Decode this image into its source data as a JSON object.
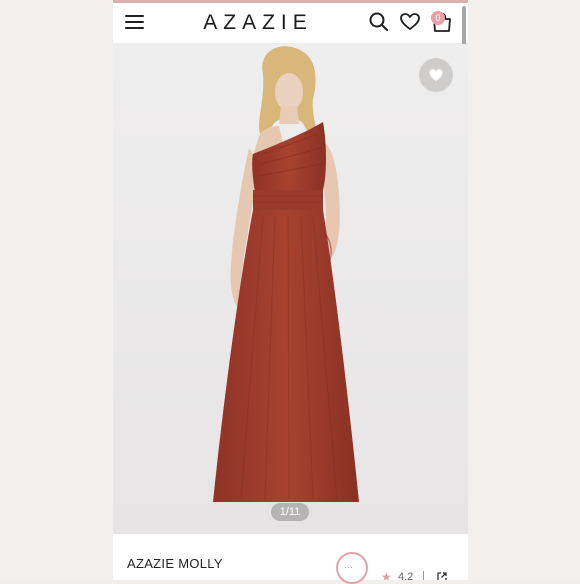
{
  "brand": {
    "logo": "AZAZIE",
    "accent": "#e8a1a7"
  },
  "header": {
    "menu_icon": "hamburger-icon",
    "search_icon": "search-icon",
    "wishlist_icon": "heart-icon",
    "bag_icon": "shopping-bag-icon",
    "bag_count": "0"
  },
  "gallery": {
    "counter": "1/11",
    "favorite_icon": "heart-icon",
    "dress_color": "#9e3a2b"
  },
  "product": {
    "name": "AZAZIE MOLLY",
    "rating": "4.2",
    "share_icon": "share-icon"
  },
  "chat": {
    "icon": "chat-icon",
    "glyph": "···"
  }
}
